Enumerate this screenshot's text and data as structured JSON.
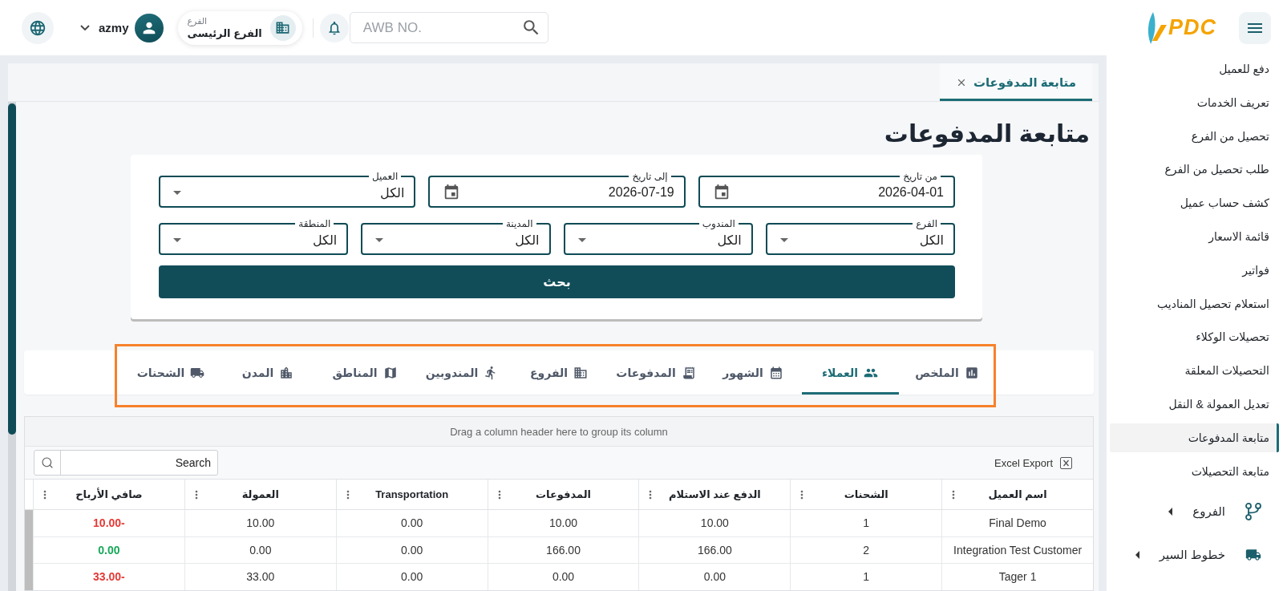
{
  "header": {
    "logo": {
      "text": "PDC"
    },
    "search": {
      "placeholder": "AWB NO."
    },
    "branch": {
      "label": "الفرع",
      "value": "الفرع الرئيسى"
    },
    "user": {
      "name": "azmy"
    }
  },
  "open_tabs": [
    {
      "label": "متابعة المدفوعات",
      "selected": true
    }
  ],
  "page_title": "متابعة المدفوعات",
  "filters": {
    "rows": [
      [
        {
          "kind": "date",
          "label": "من تاريخ",
          "value": "2026-04-01"
        },
        {
          "kind": "date",
          "label": "إلى تاريخ",
          "value": "2026-07-19"
        },
        {
          "kind": "select",
          "label": "العميل",
          "value": "الكل"
        }
      ],
      [
        {
          "kind": "select",
          "label": "الفرع",
          "value": "الكل"
        },
        {
          "kind": "select",
          "label": "المندوب",
          "value": "الكل"
        },
        {
          "kind": "select",
          "label": "المدينة",
          "value": "الكل"
        },
        {
          "kind": "select",
          "label": "المنطقة",
          "value": "الكل"
        }
      ]
    ],
    "submit": "بحث"
  },
  "report_tabs": {
    "highlighted": true,
    "tabs": [
      {
        "label": "الملخص",
        "selected": false
      },
      {
        "label": "العملاء",
        "selected": true
      },
      {
        "label": "الشهور",
        "selected": false
      },
      {
        "label": "المدفوعات",
        "selected": false
      },
      {
        "label": "الفروع",
        "selected": false
      },
      {
        "label": "المندوبين",
        "selected": false
      },
      {
        "label": "المناطق",
        "selected": false
      },
      {
        "label": "المدن",
        "selected": false
      },
      {
        "label": "الشحنات",
        "selected": false
      }
    ]
  },
  "grid": {
    "group_panel": "Drag a column header here to group its column",
    "export_button": "Excel Export",
    "search": {
      "placeholder": "Search"
    },
    "columns": [
      "اسم العميل",
      "الشحنات",
      "الدفع عند الاستلام",
      "المدفوعات",
      "Transportation",
      "العمولة",
      "صافي الأرباح"
    ],
    "rows": [
      {
        "cells": [
          "Final Demo",
          "1",
          "10.00",
          "10.00",
          "0.00",
          "10.00"
        ],
        "net_profit": "10.00-",
        "color": "#e53935"
      },
      {
        "cells": [
          "Integration Test Customer",
          "2",
          "166.00",
          "166.00",
          "0.00",
          "0.00"
        ],
        "net_profit": "0.00",
        "color": "#17a85a"
      },
      {
        "cells": [
          "Tager 1",
          "1",
          "0.00",
          "0.00",
          "0.00",
          "33.00"
        ],
        "net_profit": "33.00-",
        "color": "#e53935"
      }
    ]
  },
  "sidebar": {
    "items": [
      {
        "label": "دفع للعميل",
        "selected": false
      },
      {
        "label": "تعريف الخدمات",
        "selected": false
      },
      {
        "label": "تحصيل من الفرع",
        "selected": false
      },
      {
        "label": "طلب تحصيل من الفرع",
        "selected": false
      },
      {
        "label": "كشف حساب عميل",
        "selected": false
      },
      {
        "label": "قائمة الاسعار",
        "selected": false
      },
      {
        "label": "فواتير",
        "selected": false
      },
      {
        "label": "استعلام تحصيل المناديب",
        "selected": false
      },
      {
        "label": "تحصيلات الوكلاء",
        "selected": false
      },
      {
        "label": "التحصيلات المعلقة",
        "selected": false
      },
      {
        "label": "تعديل العمولة & النقل",
        "selected": false
      },
      {
        "label": "متابعة المدفوعات",
        "selected": true
      },
      {
        "label": "متابعة التحصيلات",
        "selected": false
      }
    ],
    "groups": [
      {
        "label": "الفروع",
        "expanded": false
      },
      {
        "label": "خطوط السير",
        "expanded": false
      }
    ]
  }
}
